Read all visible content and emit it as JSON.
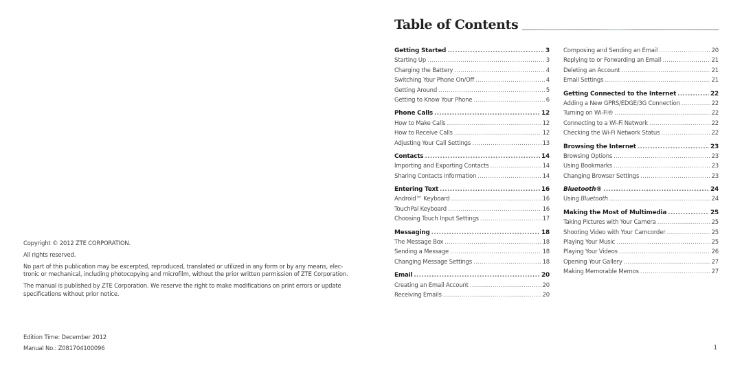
{
  "left_page": {
    "copyright": "Copyright © 2012 ZTE CORPORATION.",
    "rights": "All rights reserved.",
    "notice": "No part of this publication may be excerpted, reproduced, translated or utilized in any form or by any means, elec-tronic or mechanical, including photocopying and microfilm, without the prior written permission of ZTE Corporation.",
    "disclaimer": "The manual is published by ZTE Corporation. We reserve the right to make modifications on print errors or update specifications without prior notice.",
    "edition_time": "Edition Time: December 2012",
    "manual_no": "Manual No.: Z081704100096"
  },
  "right_page": {
    "title": "Table of Contents",
    "page_number": "1",
    "left_column": [
      {
        "title": "Getting Started",
        "page": "3",
        "items": [
          {
            "label": "Starting Up",
            "page": "3"
          },
          {
            "label": "Charging the Battery",
            "page": "4"
          },
          {
            "label": "Switching Your Phone On/Off",
            "page": "4"
          },
          {
            "label": "Getting Around",
            "page": "5"
          },
          {
            "label": "Getting to Know Your Phone",
            "page": "6"
          }
        ]
      },
      {
        "title": "Phone Calls",
        "page": "12",
        "items": [
          {
            "label": "How to Make Calls",
            "page": "12"
          },
          {
            "label": "How to Receive Calls",
            "page": "12"
          },
          {
            "label": "Adjusting Your Call Settings",
            "page": "13"
          }
        ]
      },
      {
        "title": "Contacts",
        "page": "14",
        "items": [
          {
            "label": "Importing and Exporting Contacts",
            "page": "14"
          },
          {
            "label": "Sharing Contacts Information",
            "page": "14"
          }
        ]
      },
      {
        "title": "Entering Text",
        "page": "16",
        "items": [
          {
            "label": "Android™ Keyboard",
            "page": "16"
          },
          {
            "label": "TouchPal Keyboard",
            "page": "16"
          },
          {
            "label": "Choosing Touch Input Settings",
            "page": "17"
          }
        ]
      },
      {
        "title": "Messaging",
        "page": "18",
        "items": [
          {
            "label": "The Message Box",
            "page": "18"
          },
          {
            "label": "Sending a Message",
            "page": "18"
          },
          {
            "label": "Changing Message Settings",
            "page": "18"
          }
        ]
      },
      {
        "title": "Email",
        "page": "20",
        "items": [
          {
            "label": "Creating an Email Account",
            "page": "20"
          },
          {
            "label": "Receiving Emails",
            "page": "20"
          }
        ]
      }
    ],
    "right_column_continued": [
      {
        "label": "Composing and Sending an Email",
        "page": "20"
      },
      {
        "label": "Replying to or Forwarding an Email",
        "page": "21"
      },
      {
        "label": "Deleting an Account",
        "page": "21"
      },
      {
        "label": "Email Settings",
        "page": "21"
      }
    ],
    "right_column": [
      {
        "title": "Getting Connected to the Internet",
        "page": "22",
        "items": [
          {
            "label": "Adding a New GPRS/EDGE/3G Connection",
            "page": "22"
          },
          {
            "label": "Turning on Wi-Fi®",
            "page": "22"
          },
          {
            "label": "Connecting to a Wi-Fi Network",
            "page": "22"
          },
          {
            "label": "Checking the Wi-Fi Network Status",
            "page": "22"
          }
        ]
      },
      {
        "title": "Browsing the Internet",
        "page": "23",
        "items": [
          {
            "label": "Browsing Options",
            "page": "23"
          },
          {
            "label": "Using Bookmarks",
            "page": "23"
          },
          {
            "label": "Changing Browser Settings",
            "page": "23"
          }
        ]
      },
      {
        "title": "Bluetooth®",
        "page": "24",
        "italic": true,
        "items": [
          {
            "label_prefix": "Using ",
            "label_italic": "Bluetooth",
            "page": "24"
          }
        ]
      },
      {
        "title": "Making the Most of Multimedia",
        "page": "25",
        "items": [
          {
            "label": "Taking Pictures with Your Camera",
            "page": "25"
          },
          {
            "label": "Shooting Video with Your Camcorder",
            "page": "25"
          },
          {
            "label": "Playing Your Music",
            "page": "25"
          },
          {
            "label": "Playing Your Videos",
            "page": "26"
          },
          {
            "label": "Opening Your Gallery",
            "page": "27"
          },
          {
            "label": "Making Memorable Memos",
            "page": "27"
          }
        ]
      }
    ]
  }
}
